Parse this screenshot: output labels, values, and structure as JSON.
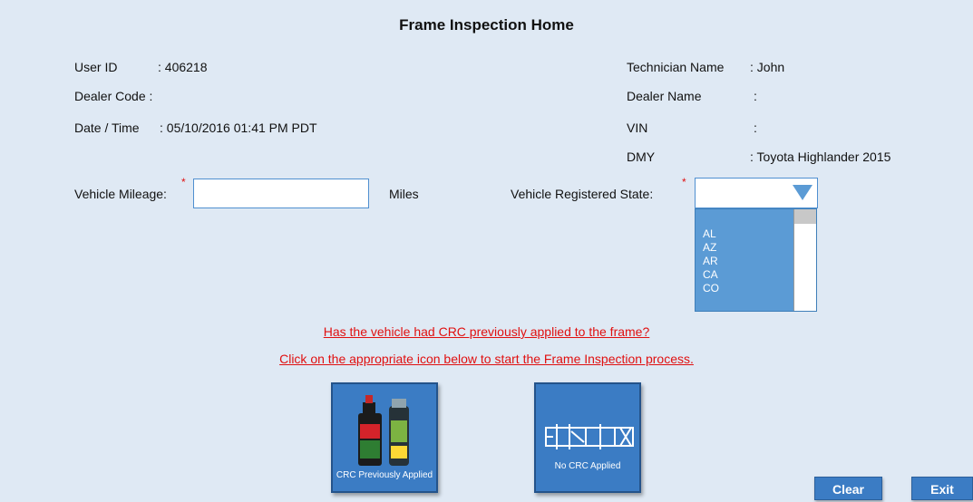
{
  "header": {
    "title": "Frame Inspection Home"
  },
  "info": {
    "user_id_label": "User ID",
    "user_id_value": ": 406218",
    "dealer_code_label": "Dealer Code :",
    "datetime_label": "Date / Time",
    "datetime_value": ": 05/10/2016 01:41 PM PDT",
    "technician_label": "Technician Name",
    "technician_value": ": John",
    "dealer_name_label": "Dealer Name",
    "dealer_name_value": ":",
    "vin_label": "VIN",
    "vin_value": ":",
    "dmy_label": "DMY",
    "dmy_value": ": Toyota Highlander 2015"
  },
  "form": {
    "mileage_label": "Vehicle Mileage:",
    "mileage_value": "",
    "mileage_unit": "Miles",
    "state_label": "Vehicle Registered State:",
    "state_value": "",
    "state_options": [
      "AL",
      "AZ",
      "AR",
      "CA",
      "CO"
    ],
    "required_mark": "*"
  },
  "prompt": {
    "question": "Has the vehicle had CRC previously applied  to the frame?",
    "instruction": "Click on the appropriate icon below to start the Frame Inspection process."
  },
  "tiles": {
    "crc_applied": "CRC Previously Applied",
    "no_crc": "No CRC Applied"
  },
  "buttons": {
    "clear": "Clear",
    "exit": "Exit"
  },
  "colors": {
    "accent": "#3b7cc4",
    "warning": "#e01010",
    "background": "#dfe9f4"
  }
}
